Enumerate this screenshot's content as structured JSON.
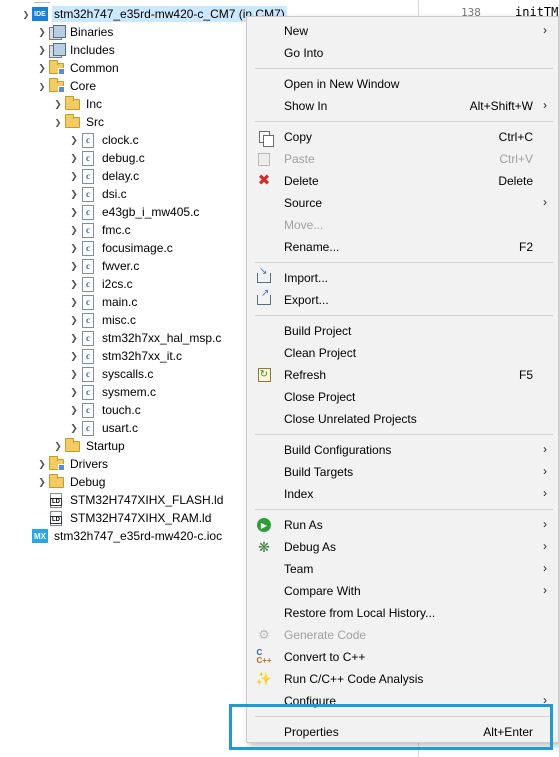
{
  "tree": {
    "items": [
      {
        "label": "stm32h747_e35rd-mw420-c_CM7 (in CM7)",
        "icon": "ide-project-icon",
        "arrow": "open",
        "selected": true
      },
      {
        "label": "Binaries",
        "icon": "binaries-icon",
        "arrow": "closed"
      },
      {
        "label": "Includes",
        "icon": "includes-icon",
        "arrow": "closed"
      },
      {
        "label": "Common",
        "icon": "folder-icon",
        "arrow": "closed"
      },
      {
        "label": "Core",
        "icon": "folder-icon",
        "arrow": "open"
      },
      {
        "label": "Inc",
        "icon": "folder-icon",
        "arrow": "closed"
      },
      {
        "label": "Src",
        "icon": "source-folder-icon",
        "arrow": "open"
      },
      {
        "label": "clock.c",
        "icon": "c-file-icon",
        "arrow": "closed"
      },
      {
        "label": "debug.c",
        "icon": "c-file-icon",
        "arrow": "closed"
      },
      {
        "label": "delay.c",
        "icon": "c-file-icon",
        "arrow": "closed"
      },
      {
        "label": "dsi.c",
        "icon": "c-file-icon",
        "arrow": "closed"
      },
      {
        "label": "e43gb_i_mw405.c",
        "icon": "c-file-icon",
        "arrow": "closed"
      },
      {
        "label": "fmc.c",
        "icon": "c-file-icon",
        "arrow": "closed"
      },
      {
        "label": "focusimage.c",
        "icon": "c-file-icon",
        "arrow": "closed"
      },
      {
        "label": "fwver.c",
        "icon": "c-file-icon",
        "arrow": "closed"
      },
      {
        "label": "i2cs.c",
        "icon": "c-file-icon",
        "arrow": "closed"
      },
      {
        "label": "main.c",
        "icon": "c-file-icon",
        "arrow": "closed"
      },
      {
        "label": "misc.c",
        "icon": "c-file-icon",
        "arrow": "closed"
      },
      {
        "label": "stm32h7xx_hal_msp.c",
        "icon": "c-file-icon",
        "arrow": "closed"
      },
      {
        "label": "stm32h7xx_it.c",
        "icon": "c-file-icon",
        "arrow": "closed"
      },
      {
        "label": "syscalls.c",
        "icon": "c-file-icon",
        "arrow": "closed"
      },
      {
        "label": "sysmem.c",
        "icon": "c-file-icon",
        "arrow": "closed"
      },
      {
        "label": "touch.c",
        "icon": "c-file-icon",
        "arrow": "closed"
      },
      {
        "label": "usart.c",
        "icon": "c-file-icon",
        "arrow": "closed"
      },
      {
        "label": "Startup",
        "icon": "folder-icon",
        "arrow": "closed"
      },
      {
        "label": "Drivers",
        "icon": "folder-icon",
        "arrow": "closed"
      },
      {
        "label": "Debug",
        "icon": "folder-icon",
        "arrow": "closed"
      },
      {
        "label": "STM32H747XIHX_FLASH.ld",
        "icon": "linker-script-icon",
        "arrow": "none"
      },
      {
        "label": "STM32H747XIHX_RAM.ld",
        "icon": "linker-script-icon",
        "arrow": "none"
      },
      {
        "label": "stm32h747_e35rd-mw420-c.ioc",
        "icon": "cubemx-ioc-icon",
        "arrow": "none"
      }
    ]
  },
  "editor": {
    "line_number": "138",
    "code": "initTM"
  },
  "menu": {
    "items": [
      {
        "label": "New",
        "shortcut": "",
        "submenu": true,
        "icon": "",
        "enabled": true
      },
      {
        "label": "Go Into",
        "shortcut": "",
        "submenu": false,
        "icon": "",
        "enabled": true
      },
      {
        "label": "Open in New Window",
        "shortcut": "",
        "submenu": false,
        "icon": "",
        "enabled": true
      },
      {
        "label": "Show In",
        "shortcut": "Alt+Shift+W",
        "submenu": true,
        "icon": "",
        "enabled": true
      },
      {
        "label": "Copy",
        "shortcut": "Ctrl+C",
        "submenu": false,
        "icon": "copy-icon",
        "enabled": true
      },
      {
        "label": "Paste",
        "shortcut": "Ctrl+V",
        "submenu": false,
        "icon": "paste-icon",
        "enabled": false
      },
      {
        "label": "Delete",
        "shortcut": "Delete",
        "submenu": false,
        "icon": "delete-icon",
        "enabled": true
      },
      {
        "label": "Source",
        "shortcut": "",
        "submenu": true,
        "icon": "",
        "enabled": true
      },
      {
        "label": "Move...",
        "shortcut": "",
        "submenu": false,
        "icon": "",
        "enabled": false
      },
      {
        "label": "Rename...",
        "shortcut": "F2",
        "submenu": false,
        "icon": "",
        "enabled": true
      },
      {
        "label": "Import...",
        "shortcut": "",
        "submenu": false,
        "icon": "import-icon",
        "enabled": true
      },
      {
        "label": "Export...",
        "shortcut": "",
        "submenu": false,
        "icon": "export-icon",
        "enabled": true
      },
      {
        "label": "Build Project",
        "shortcut": "",
        "submenu": false,
        "icon": "",
        "enabled": true
      },
      {
        "label": "Clean Project",
        "shortcut": "",
        "submenu": false,
        "icon": "",
        "enabled": true
      },
      {
        "label": "Refresh",
        "shortcut": "F5",
        "submenu": false,
        "icon": "refresh-icon",
        "enabled": true
      },
      {
        "label": "Close Project",
        "shortcut": "",
        "submenu": false,
        "icon": "",
        "enabled": true
      },
      {
        "label": "Close Unrelated Projects",
        "shortcut": "",
        "submenu": false,
        "icon": "",
        "enabled": true
      },
      {
        "label": "Build Configurations",
        "shortcut": "",
        "submenu": true,
        "icon": "",
        "enabled": true
      },
      {
        "label": "Build Targets",
        "shortcut": "",
        "submenu": true,
        "icon": "",
        "enabled": true
      },
      {
        "label": "Index",
        "shortcut": "",
        "submenu": true,
        "icon": "",
        "enabled": true
      },
      {
        "label": "Run As",
        "shortcut": "",
        "submenu": true,
        "icon": "run-icon",
        "enabled": true
      },
      {
        "label": "Debug As",
        "shortcut": "",
        "submenu": true,
        "icon": "debug-icon",
        "enabled": true
      },
      {
        "label": "Team",
        "shortcut": "",
        "submenu": true,
        "icon": "",
        "enabled": true
      },
      {
        "label": "Compare With",
        "shortcut": "",
        "submenu": true,
        "icon": "",
        "enabled": true
      },
      {
        "label": "Restore from Local History...",
        "shortcut": "",
        "submenu": false,
        "icon": "",
        "enabled": true
      },
      {
        "label": "Generate Code",
        "shortcut": "",
        "submenu": false,
        "icon": "generate-code-icon",
        "enabled": false
      },
      {
        "label": "Convert to C++",
        "shortcut": "",
        "submenu": false,
        "icon": "convert-cpp-icon",
        "enabled": true
      },
      {
        "label": "Run C/C++ Code Analysis",
        "shortcut": "",
        "submenu": false,
        "icon": "code-analysis-icon",
        "enabled": true
      },
      {
        "label": "Configure",
        "shortcut": "",
        "submenu": true,
        "icon": "",
        "enabled": true
      },
      {
        "label": "Properties",
        "shortcut": "Alt+Enter",
        "submenu": false,
        "icon": "",
        "enabled": true
      }
    ]
  },
  "colors": {
    "selection": "#cce8ff",
    "highlight_frame": "#1f9bd1",
    "menu_background": "#f2f2f2",
    "disabled_text": "#a0a0a0"
  }
}
